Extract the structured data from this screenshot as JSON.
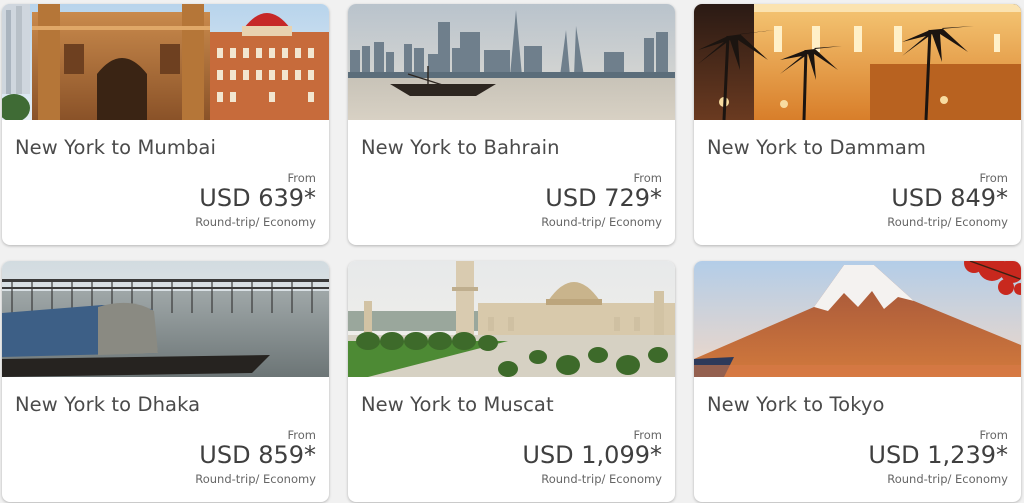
{
  "offers": [
    {
      "route": "New York to Mumbai",
      "from_label": "From",
      "price": "USD 639*",
      "fare_type": "Round-trip/ Economy",
      "image": "gateway-of-india-image"
    },
    {
      "route": "New York to Bahrain",
      "from_label": "From",
      "price": "USD 729*",
      "fare_type": "Round-trip/ Economy",
      "image": "bahrain-skyline-image"
    },
    {
      "route": "New York to Dammam",
      "from_label": "From",
      "price": "USD 849*",
      "fare_type": "Round-trip/ Economy",
      "image": "dammam-night-palms-image"
    },
    {
      "route": "New York to Dhaka",
      "from_label": "From",
      "price": "USD 859*",
      "fare_type": "Round-trip/ Economy",
      "image": "dhaka-river-boat-image"
    },
    {
      "route": "New York to Muscat",
      "from_label": "From",
      "price": "USD 1,099*",
      "fare_type": "Round-trip/ Economy",
      "image": "muscat-grand-mosque-image"
    },
    {
      "route": "New York to Tokyo",
      "from_label": "From",
      "price": "USD 1,239*",
      "fare_type": "Round-trip/ Economy",
      "image": "mount-fuji-image"
    }
  ]
}
